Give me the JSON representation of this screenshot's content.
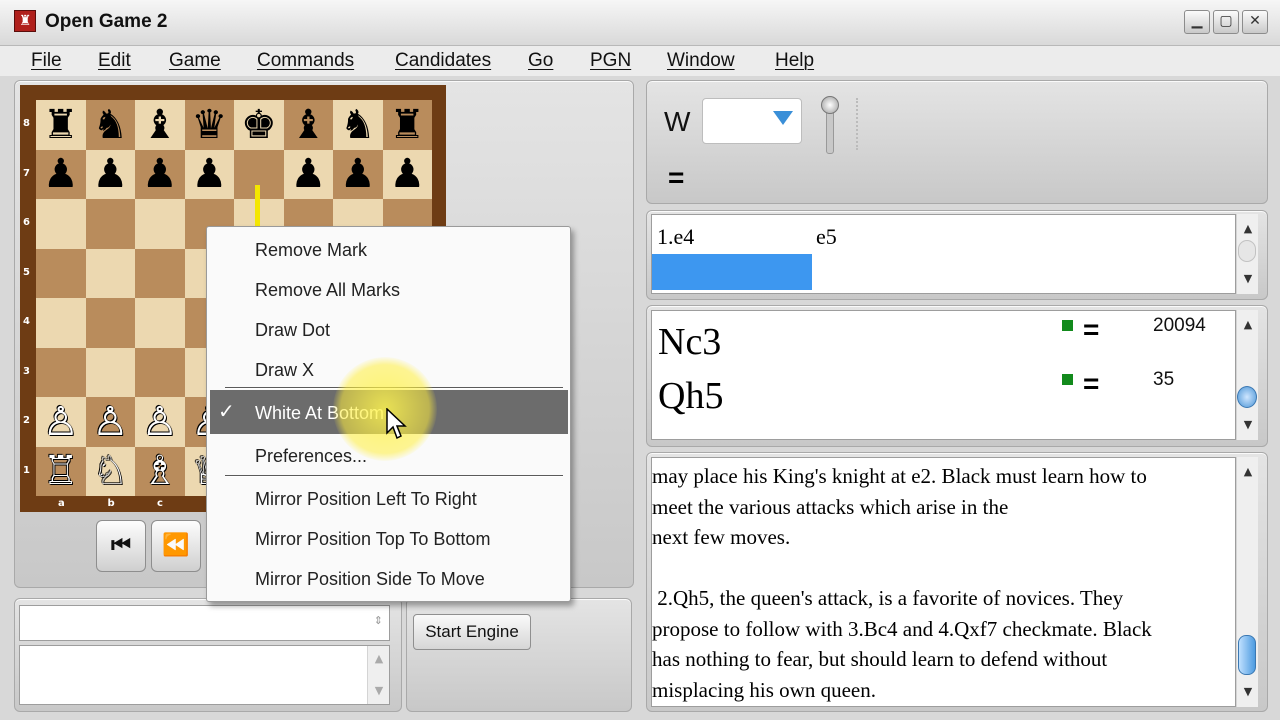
{
  "window": {
    "title": "Open Game 2",
    "app_icon": "chess-app-icon",
    "controls": {
      "minimize": "▁",
      "maximize": "▢",
      "close": "✕"
    }
  },
  "menu": [
    "File",
    "Edit",
    "Game",
    "Commands",
    "Candidates",
    "Go",
    "PGN",
    "Window",
    "Help"
  ],
  "board": {
    "ranks": [
      "8",
      "7",
      "6",
      "5",
      "4",
      "3",
      "2",
      "1"
    ],
    "files": [
      "a",
      "b",
      "c"
    ],
    "rows": [
      [
        "♜",
        "♞",
        "♝",
        "♛",
        "♚",
        "♝",
        "♞",
        "♜"
      ],
      [
        "♟",
        "♟",
        "♟",
        "♟",
        "",
        "♟",
        "♟",
        "♟"
      ],
      [
        "",
        "",
        "",
        "",
        "",
        "",
        "",
        ""
      ],
      [
        "",
        "",
        "",
        "",
        "",
        "",
        "",
        ""
      ],
      [
        "",
        "",
        "",
        "",
        "",
        "",
        "",
        ""
      ],
      [
        "",
        "",
        "",
        "",
        "",
        "",
        "",
        ""
      ],
      [
        "♙",
        "♙",
        "♙",
        "♙",
        "",
        "",
        "",
        ""
      ],
      [
        "♖",
        "♘",
        "♗",
        "♕",
        "",
        "",
        "",
        ""
      ]
    ]
  },
  "nav_buttons": {
    "first": "⏮",
    "prev": "⏪"
  },
  "context_menu": {
    "items": [
      "Remove Mark",
      "Remove All Marks",
      "Draw Dot",
      "Draw X",
      "White At Bottom",
      "Preferences...",
      "Mirror Position Left To Right",
      "Mirror Position Top To Bottom",
      "Mirror Position Side To Move"
    ],
    "checked": "White At Bottom",
    "check_mark": "✓"
  },
  "evaluation": {
    "side": "W",
    "value": "="
  },
  "game_moves": {
    "white_move": "1.e4",
    "black_move": "e5"
  },
  "candidates": [
    {
      "move": "Nc3",
      "eval": "=",
      "count": "20094"
    },
    {
      "move": "Qh5",
      "eval": "=",
      "count": "35"
    }
  ],
  "notes_text": "may place his King's knight at e2. Black must learn how to\nmeet the various attacks which arise in the\nnext few moves.\n\n 2.Qh5, the queen's attack, is a favorite of novices. They\npropose to follow with 3.Bc4 and 4.Qxf7 checkmate. Black\nhas nothing to fear, but should learn to defend without\nmisplacing his own queen.",
  "engine": {
    "start_label": "Start Engine"
  },
  "colors": {
    "board_light": "#ecd8b0",
    "board_dark": "#b98c5c",
    "selection_blue": "#3d97f0",
    "highlight": "#fff250",
    "candidate_marker": "#128a1c"
  }
}
